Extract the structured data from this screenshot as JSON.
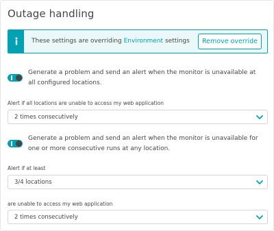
{
  "section": {
    "title": "Outage handling"
  },
  "banner": {
    "text_before": "These settings are overriding ",
    "link": "Environment",
    "text_after": " settings",
    "button": "Remove override",
    "icon": "info-icon",
    "accent": "#00a1b2"
  },
  "toggle_all_locations": {
    "state": "on",
    "label": "Generate a problem and send an alert when the monitor is unavailable at all configured locations."
  },
  "field_all_locations": {
    "label": "Alert if all locations are unable to access my web application",
    "value": "2 times consecutively"
  },
  "toggle_consecutive_runs": {
    "state": "on",
    "label": "Generate a problem and send an alert when the monitor is unavailable for one or more consecutive runs at any location."
  },
  "field_alert_at_least": {
    "label": "Alert if at least",
    "value": "3/4 locations"
  },
  "field_unable_access": {
    "label": "are unable to access my web application",
    "value": "2 times consecutively"
  }
}
